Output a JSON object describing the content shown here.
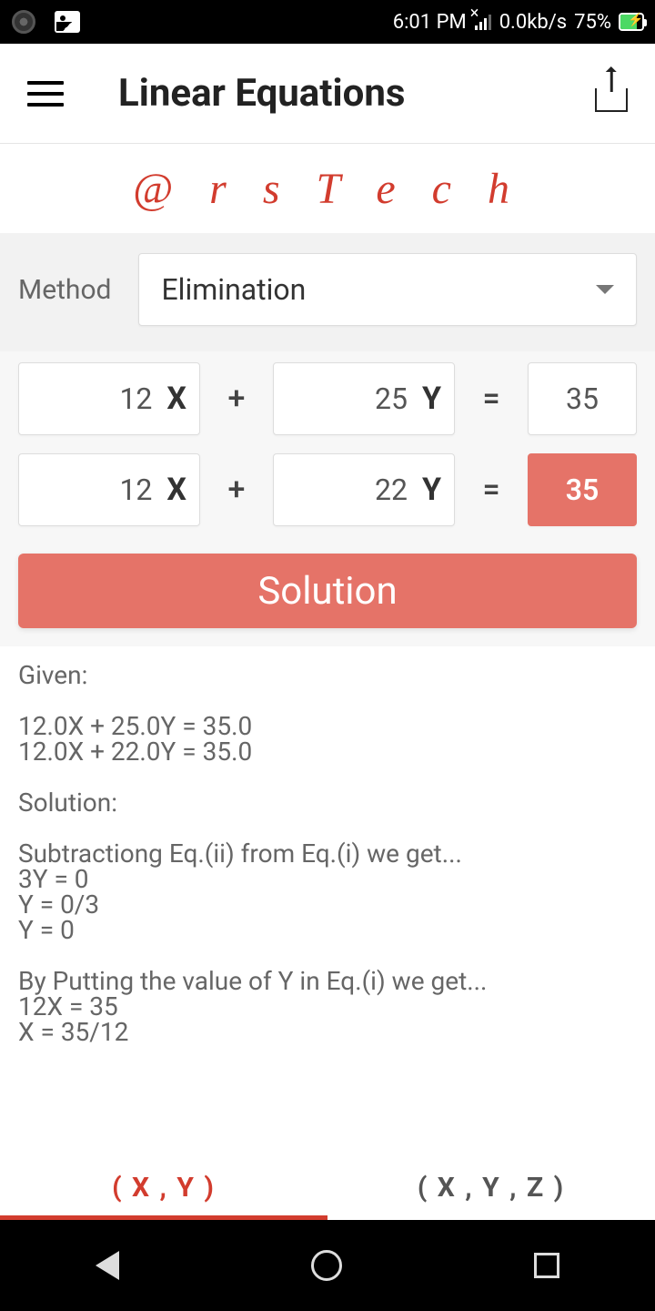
{
  "statusbar": {
    "time": "6:01 PM",
    "netspeed": "0.0kb/s",
    "battery_pct": "75%"
  },
  "appbar": {
    "title": "Linear Equations"
  },
  "brand": "@ r s T e c h",
  "method": {
    "label": "Method",
    "selected": "Elimination"
  },
  "eq1": {
    "a": "12",
    "avar": "X",
    "plus": "+",
    "b": "25",
    "bvar": "Y",
    "eq": "=",
    "c": "35"
  },
  "eq2": {
    "a": "12",
    "avar": "X",
    "plus": "+",
    "b": "22",
    "bvar": "Y",
    "eq": "=",
    "c": "35"
  },
  "solution_btn": "Solution",
  "solution_text": "Given:\n\n12.0X  +  25.0Y  =  35.0\n12.0X  +  22.0Y  =  35.0\n\nSolution:\n\nSubtractiong Eq.(ii) from Eq.(i) we get...\n3Y  =  0\nY  =  0/3\nY = 0\n\nBy Putting the value of Y in Eq.(i) we get...\n12X = 35\nX = 35/12",
  "tabs": {
    "xy": "( X , Y )",
    "xyz": "( X , Y , Z )"
  }
}
